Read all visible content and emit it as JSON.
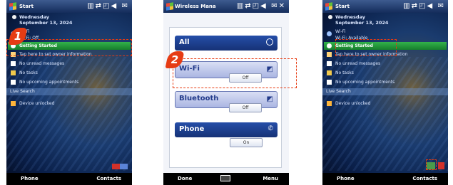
{
  "screen1": {
    "title": "Start",
    "date": [
      "Wednesday",
      "September 13, 2024"
    ],
    "wifi_label": "Wi-Fi",
    "wifi_status": "Wi-Fi: Off",
    "items": [
      "Getting Started",
      "Tap here to set owner information",
      "No unread messages",
      "No tasks",
      "No upcoming appointments"
    ],
    "live_search": "Live Search",
    "lock": "Device unlocked",
    "left_soft": "Phone",
    "right_soft": "Contacts",
    "callout": "1"
  },
  "screen2": {
    "title": "Wireless Mana",
    "all": "All",
    "wifi": "Wi-Fi",
    "wifi_btn": "Off",
    "bt": "Bluetooth",
    "bt_btn": "Off",
    "phone": "Phone",
    "phone_btn": "On",
    "left_soft": "Done",
    "right_soft": "Menu",
    "callout": "2"
  },
  "screen3": {
    "title": "Start",
    "date": [
      "Wednesday",
      "September 13, 2024"
    ],
    "wifi_label": "Wi-Fi",
    "wifi_status": "Wi-Fi: Available",
    "items": [
      "Getting Started",
      "Tap here to set owner information",
      "No unread messages",
      "No tasks",
      "No upcoming appointments"
    ],
    "live_search": "Live Search",
    "lock": "Device unlocked",
    "left_soft": "Phone",
    "right_soft": "Contacts"
  },
  "colors": {
    "callout": "#e63c14",
    "section_header": "#1d3f95"
  }
}
